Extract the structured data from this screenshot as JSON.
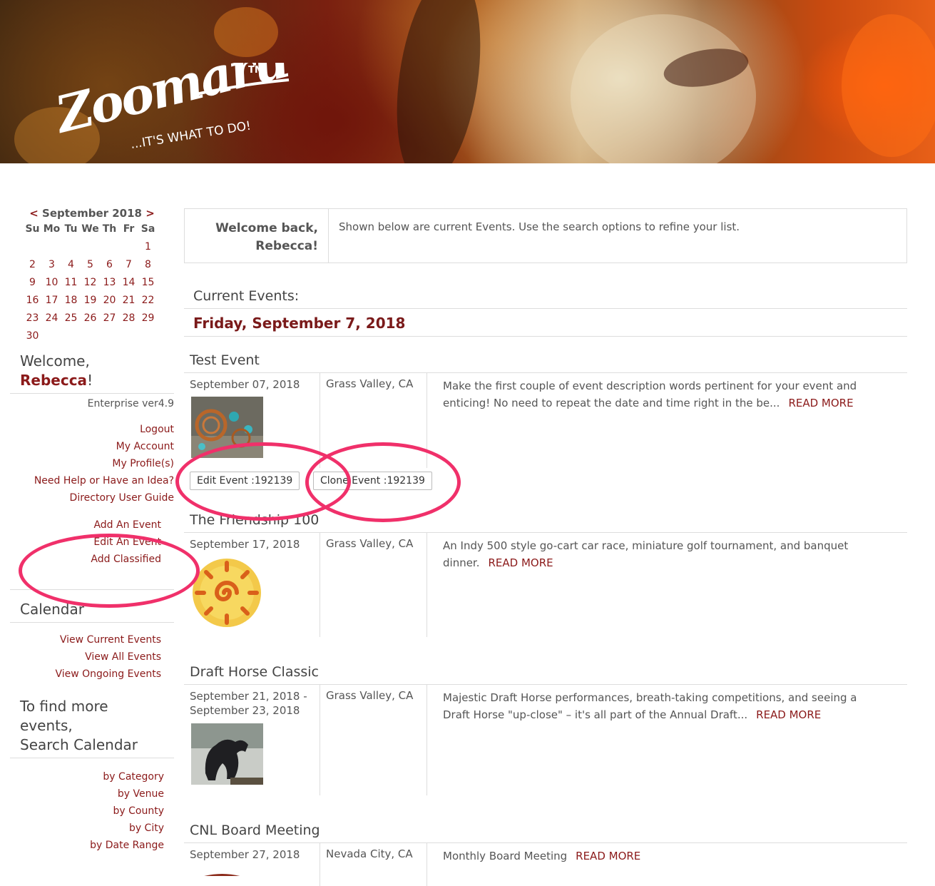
{
  "brand": {
    "logo_text": "Zoomaru",
    "tm": "TM",
    "tagline": "...IT'S WHAT TO DO!"
  },
  "calendar": {
    "prev": "<",
    "month_label": "September 2018",
    "next": ">",
    "weekdays": [
      "Su",
      "Mo",
      "Tu",
      "We",
      "Th",
      "Fr",
      "Sa"
    ],
    "weeks": [
      [
        "",
        "",
        "",
        "",
        "",
        "",
        "1"
      ],
      [
        "2",
        "3",
        "4",
        "5",
        "6",
        "7",
        "8"
      ],
      [
        "9",
        "10",
        "11",
        "12",
        "13",
        "14",
        "15"
      ],
      [
        "16",
        "17",
        "18",
        "19",
        "20",
        "21",
        "22"
      ],
      [
        "23",
        "24",
        "25",
        "26",
        "27",
        "28",
        "29"
      ],
      [
        "30",
        "",
        "",
        "",
        "",
        "",
        ""
      ]
    ]
  },
  "sidebar": {
    "welcome": "Welcome,",
    "user_name": "Rebecca",
    "welcome_suffix": "!",
    "version": "Enterprise ver4.9",
    "account_links": [
      "Logout",
      "My Account",
      "My Profile(s)",
      "Need Help or Have an Idea?",
      "Directory User Guide"
    ],
    "event_links": [
      "Add An Event",
      "Edit An Event",
      "Add Classified"
    ],
    "calendar_heading": "Calendar",
    "calendar_links": [
      "View Current Events",
      "View All Events",
      "View Ongoing Events"
    ],
    "search_heading_1": "To find more",
    "search_heading_2": "events,",
    "search_heading_3": "Search Calendar",
    "search_links": [
      "by Category",
      "by Venue",
      "by County",
      "by City",
      "by Date Range"
    ]
  },
  "main": {
    "welcome_line1": "Welcome back,",
    "welcome_line2": "Rebecca!",
    "intro": "Shown below are current Events. Use the search options to refine your list.",
    "current_label": "Current Events:",
    "date_heading": "Friday, September 7, 2018",
    "read_more": "READ MORE",
    "events": [
      {
        "title": "Test Event",
        "date1": "September 07, 2018",
        "date2": "",
        "city": "Grass Valley, CA",
        "desc": "Make the first couple of event description words pertinent for your event and enticing! No need to repeat the date and time right in the be...",
        "thumb": "jewelry-photo"
      },
      {
        "title": "The Friendship 100",
        "date1": "September 17, 2018",
        "date2": "",
        "city": "Grass Valley, CA",
        "desc": "An Indy 500 style go-cart car race, miniature golf tournament, and banquet dinner.",
        "thumb": "sun-logo"
      },
      {
        "title": "Draft Horse Classic",
        "date1": "September 21, 2018 -",
        "date2": "September 23, 2018",
        "city": "Grass Valley, CA",
        "desc": "Majestic Draft Horse performances, breath-taking competitions, and seeing a Draft Horse \"up-close\" – it's all part of the Annual Draft...",
        "thumb": "horse-photo"
      },
      {
        "title": "CNL Board Meeting",
        "date1": "September 27, 2018",
        "date2": "",
        "city": "Nevada City, CA",
        "desc": "Monthly Board Meeting",
        "thumb": "logo"
      }
    ],
    "edit_button": "Edit Event :192139",
    "clone_button": "Clone Event :192139"
  },
  "colors": {
    "accent": "#8b1a1a",
    "highlight_ring": "#f0306a"
  }
}
